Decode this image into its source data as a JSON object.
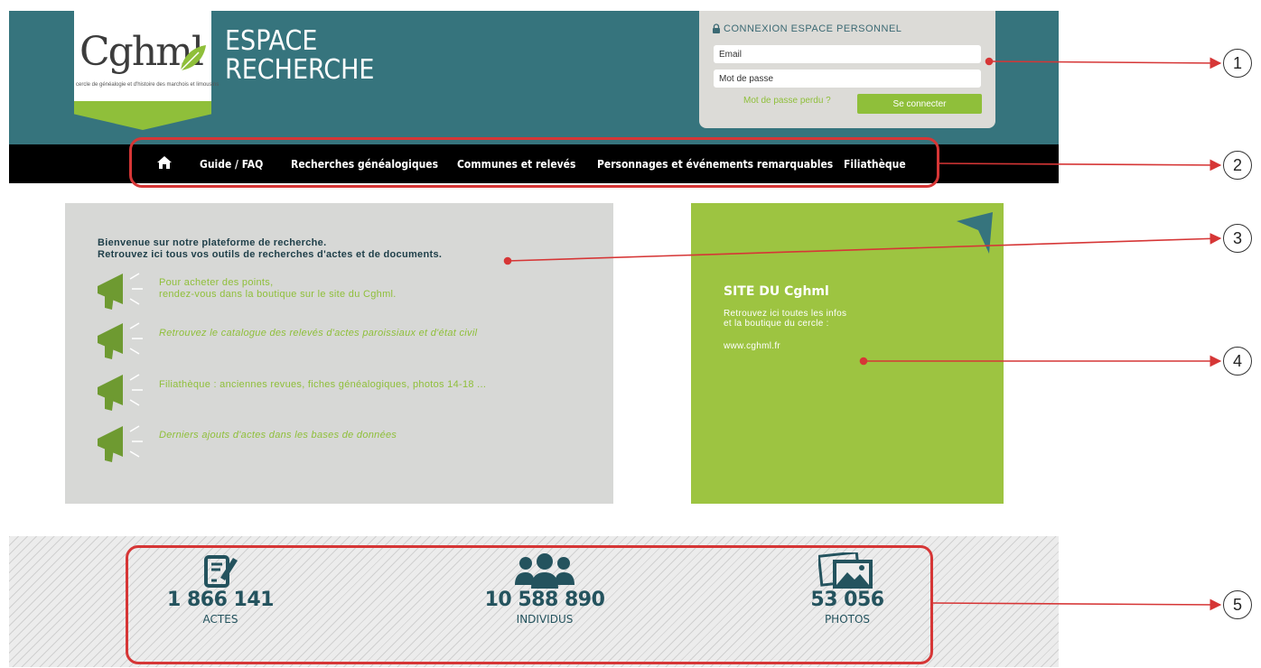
{
  "header": {
    "logo": {
      "word": "Cghml",
      "caption": "cercle de généalogie et d'histoire des marchois et limousins"
    },
    "title_line1": "ESPACE",
    "title_line2": "RECHERCHE",
    "colors": {
      "teal": "#36747d",
      "green": "#8fbf3a"
    }
  },
  "login": {
    "title": "CONNEXION ESPACE PERSONNEL",
    "email_placeholder": "Email",
    "password_placeholder": "Mot de passe",
    "forgot_link": "Mot de passe perdu ?",
    "submit_label": "Se connecter"
  },
  "nav": {
    "home_icon": "home-icon",
    "items": [
      {
        "label": "Guide / FAQ"
      },
      {
        "label": "Recherches généalogiques"
      },
      {
        "label": "Communes et relevés"
      },
      {
        "label": "Personnages et événements remarquables"
      },
      {
        "label": "Filiathèque"
      }
    ]
  },
  "welcome": {
    "line1": "Bienvenue sur notre plateforme de recherche.",
    "line2": "Retrouvez ici tous vos outils de recherches d'actes et de documents.",
    "icon": "megaphone-icon",
    "items": [
      {
        "line1": "Pour acheter des points,",
        "line2": "rendez-vous dans la boutique sur le site du Cghml."
      },
      {
        "line1": "Retrouvez le catalogue des relevés d'actes paroissiaux et d'état civil"
      },
      {
        "line1": "Filiathèque : anciennes revues, fiches généalogiques, photos 14-18 ..."
      },
      {
        "line1": "Derniers ajouts d'actes dans les bases de données"
      }
    ]
  },
  "site_panel": {
    "title": "SITE DU Cghml",
    "desc1": "Retrouvez ici toutes les infos",
    "desc2": "et la boutique du cercle :",
    "url": "www.cghml.fr"
  },
  "stats": [
    {
      "icon": "document-edit-icon",
      "number": "1 866 141",
      "label": "ACTES"
    },
    {
      "icon": "users-icon",
      "number": "10 588 890",
      "label": "INDIVIDUS"
    },
    {
      "icon": "photos-icon",
      "number": "53 056",
      "label": "PHOTOS"
    }
  ],
  "callouts": [
    "1",
    "2",
    "3",
    "4",
    "5"
  ]
}
